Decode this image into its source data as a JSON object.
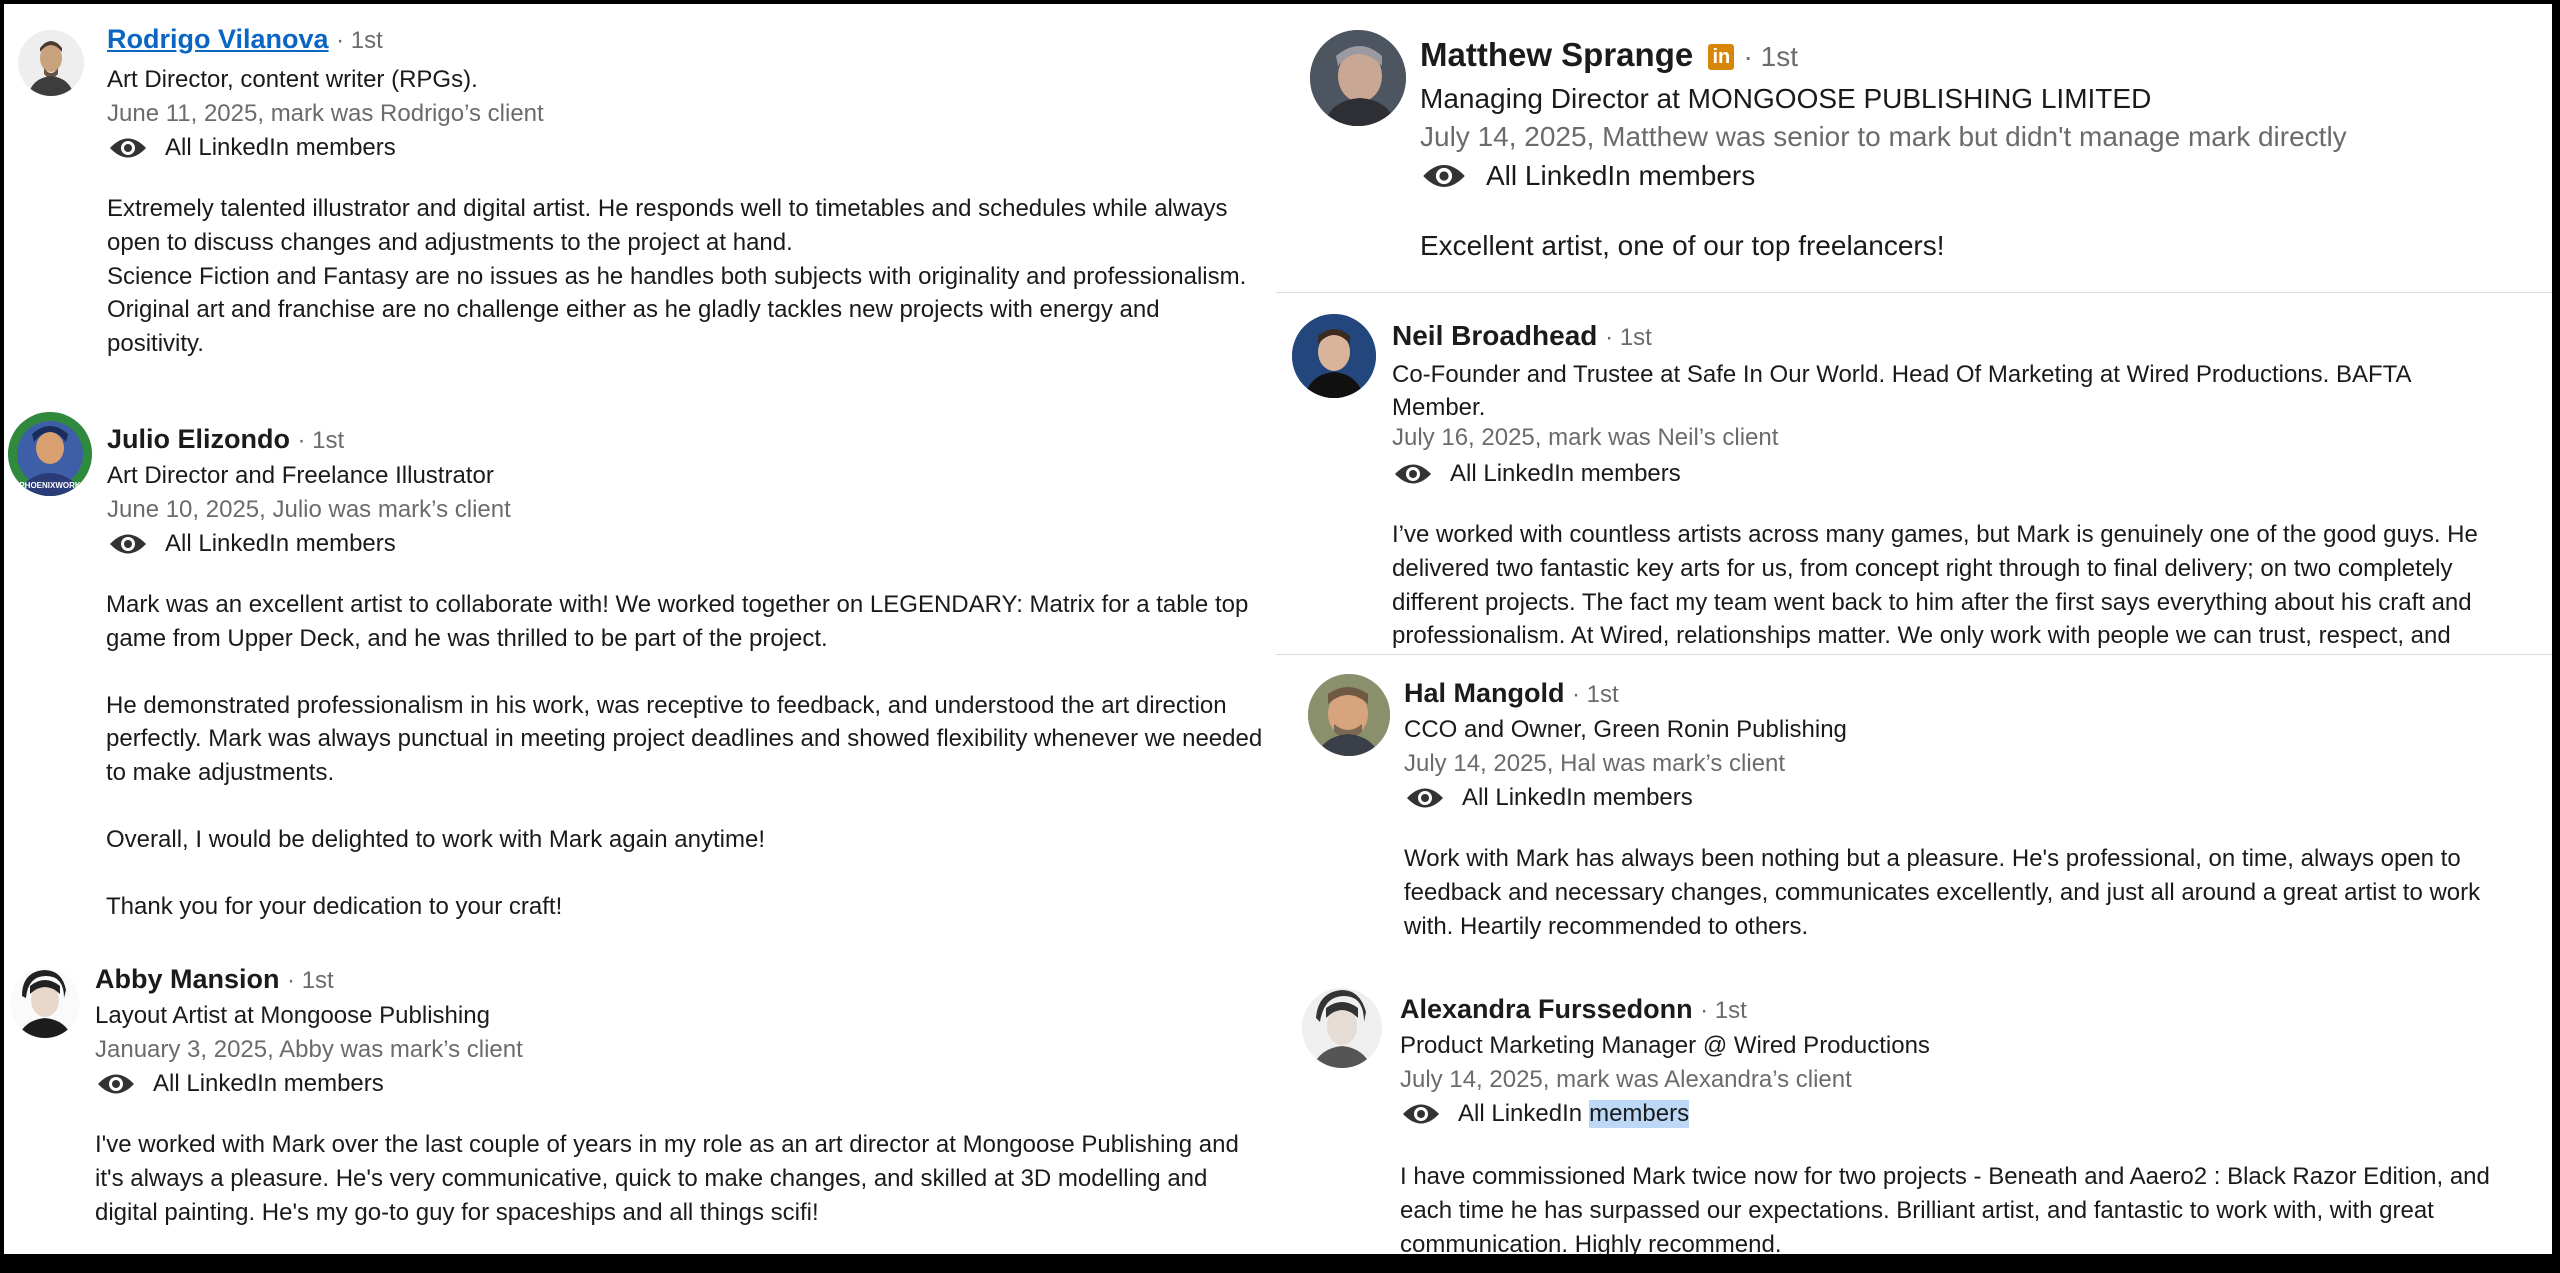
{
  "recommendations": [
    {
      "name": "Rodrigo Vilanova",
      "degree": "· 1st",
      "headline": "Art Director, content writer (RPGs).",
      "meta": "June 11, 2025, mark was Rodrigo’s client",
      "visibility": "All LinkedIn members",
      "body": [
        "Extremely talented illustrator and digital artist. He responds well to timetables and schedules while always open to discuss changes and adjustments to the project at hand.",
        "Science Fiction and Fantasy are no issues as he handles both subjects with originality and professionalism.",
        "Original art and franchise are no challenge either as he gladly tackles new projects with energy and positivity."
      ]
    },
    {
      "name": "Julio Elizondo",
      "degree": "· 1st",
      "headline": "Art Director and Freelance Illustrator",
      "meta": "June 10, 2025, Julio was mark’s client",
      "visibility": "All LinkedIn members",
      "avatar_text": "PHOENIXWORK",
      "body": [
        "Mark was an excellent artist to collaborate with! We worked together on LEGENDARY: Matrix for a table top game from Upper Deck, and he was thrilled to be part of the project.",
        "He demonstrated professionalism in his work, was receptive to feedback, and understood the art direction perfectly. Mark was always punctual in meeting project deadlines and showed flexibility whenever we needed to make adjustments.",
        "Overall, I would be delighted to work with Mark again anytime!",
        "Thank you for your dedication to your craft!"
      ]
    },
    {
      "name": "Abby Mansion",
      "degree": "· 1st",
      "headline": "Layout Artist at Mongoose Publishing",
      "meta": "January 3, 2025, Abby was mark’s client",
      "visibility": "All LinkedIn members",
      "body": [
        "I've worked with Mark over the last couple of years in my role as an art director at Mongoose Publishing and it's always a pleasure. He's very communicative, quick to make changes, and skilled at 3D modelling and digital painting. He's my go-to guy for spaceships and all things scifi!"
      ]
    },
    {
      "name": "Matthew Sprange",
      "degree": "· 1st",
      "badge": "in",
      "headline": "Managing Director at MONGOOSE PUBLISHING LIMITED",
      "meta": "July 14, 2025, Matthew was senior to mark but didn't manage mark directly",
      "visibility": "All LinkedIn members",
      "body": [
        "Excellent artist, one of our top freelancers!"
      ]
    },
    {
      "name": "Neil Broadhead",
      "degree": "· 1st",
      "headline": "Co-Founder and Trustee at Safe In Our World. Head Of Marketing at Wired Productions. BAFTA Member.",
      "meta": "July 16, 2025, mark was Neil’s client",
      "visibility": "All LinkedIn members",
      "body": [
        "I’ve worked with countless artists across many games, but Mark is genuinely one of the good guys. He delivered two fantastic key arts for us, from concept right through to final delivery; on two completely different projects. The fact my team went back to him after the first says everything about his craft and professionalism. At Wired, relationships matter. We only work with people we can trust, respect, and"
      ]
    },
    {
      "name": "Hal Mangold",
      "degree": "· 1st",
      "headline": "CCO and Owner, Green Ronin Publishing",
      "meta": "July 14, 2025, Hal was mark’s client",
      "visibility": "All LinkedIn members",
      "body": [
        "Work with Mark has always been nothing but a pleasure. He's professional, on time, always open to feedback and necessary changes, communicates excellently, and just all around a great artist to work with. Heartily recommended to others."
      ]
    },
    {
      "name": "Alexandra Furssedonn",
      "degree": "· 1st",
      "headline": "Product Marketing Manager @ Wired Productions",
      "meta": "July 14, 2025, mark was Alexandra’s client",
      "visibility_prefix": "All LinkedIn",
      "visibility_highlight": "members",
      "body": [
        "I have commissioned Mark twice now for two projects - Beneath and Aaero2 : Black Razor Edition, and each time he has surpassed our expectations. Brilliant artist, and fantastic to work with, with great communication. Highly recommend."
      ]
    }
  ]
}
